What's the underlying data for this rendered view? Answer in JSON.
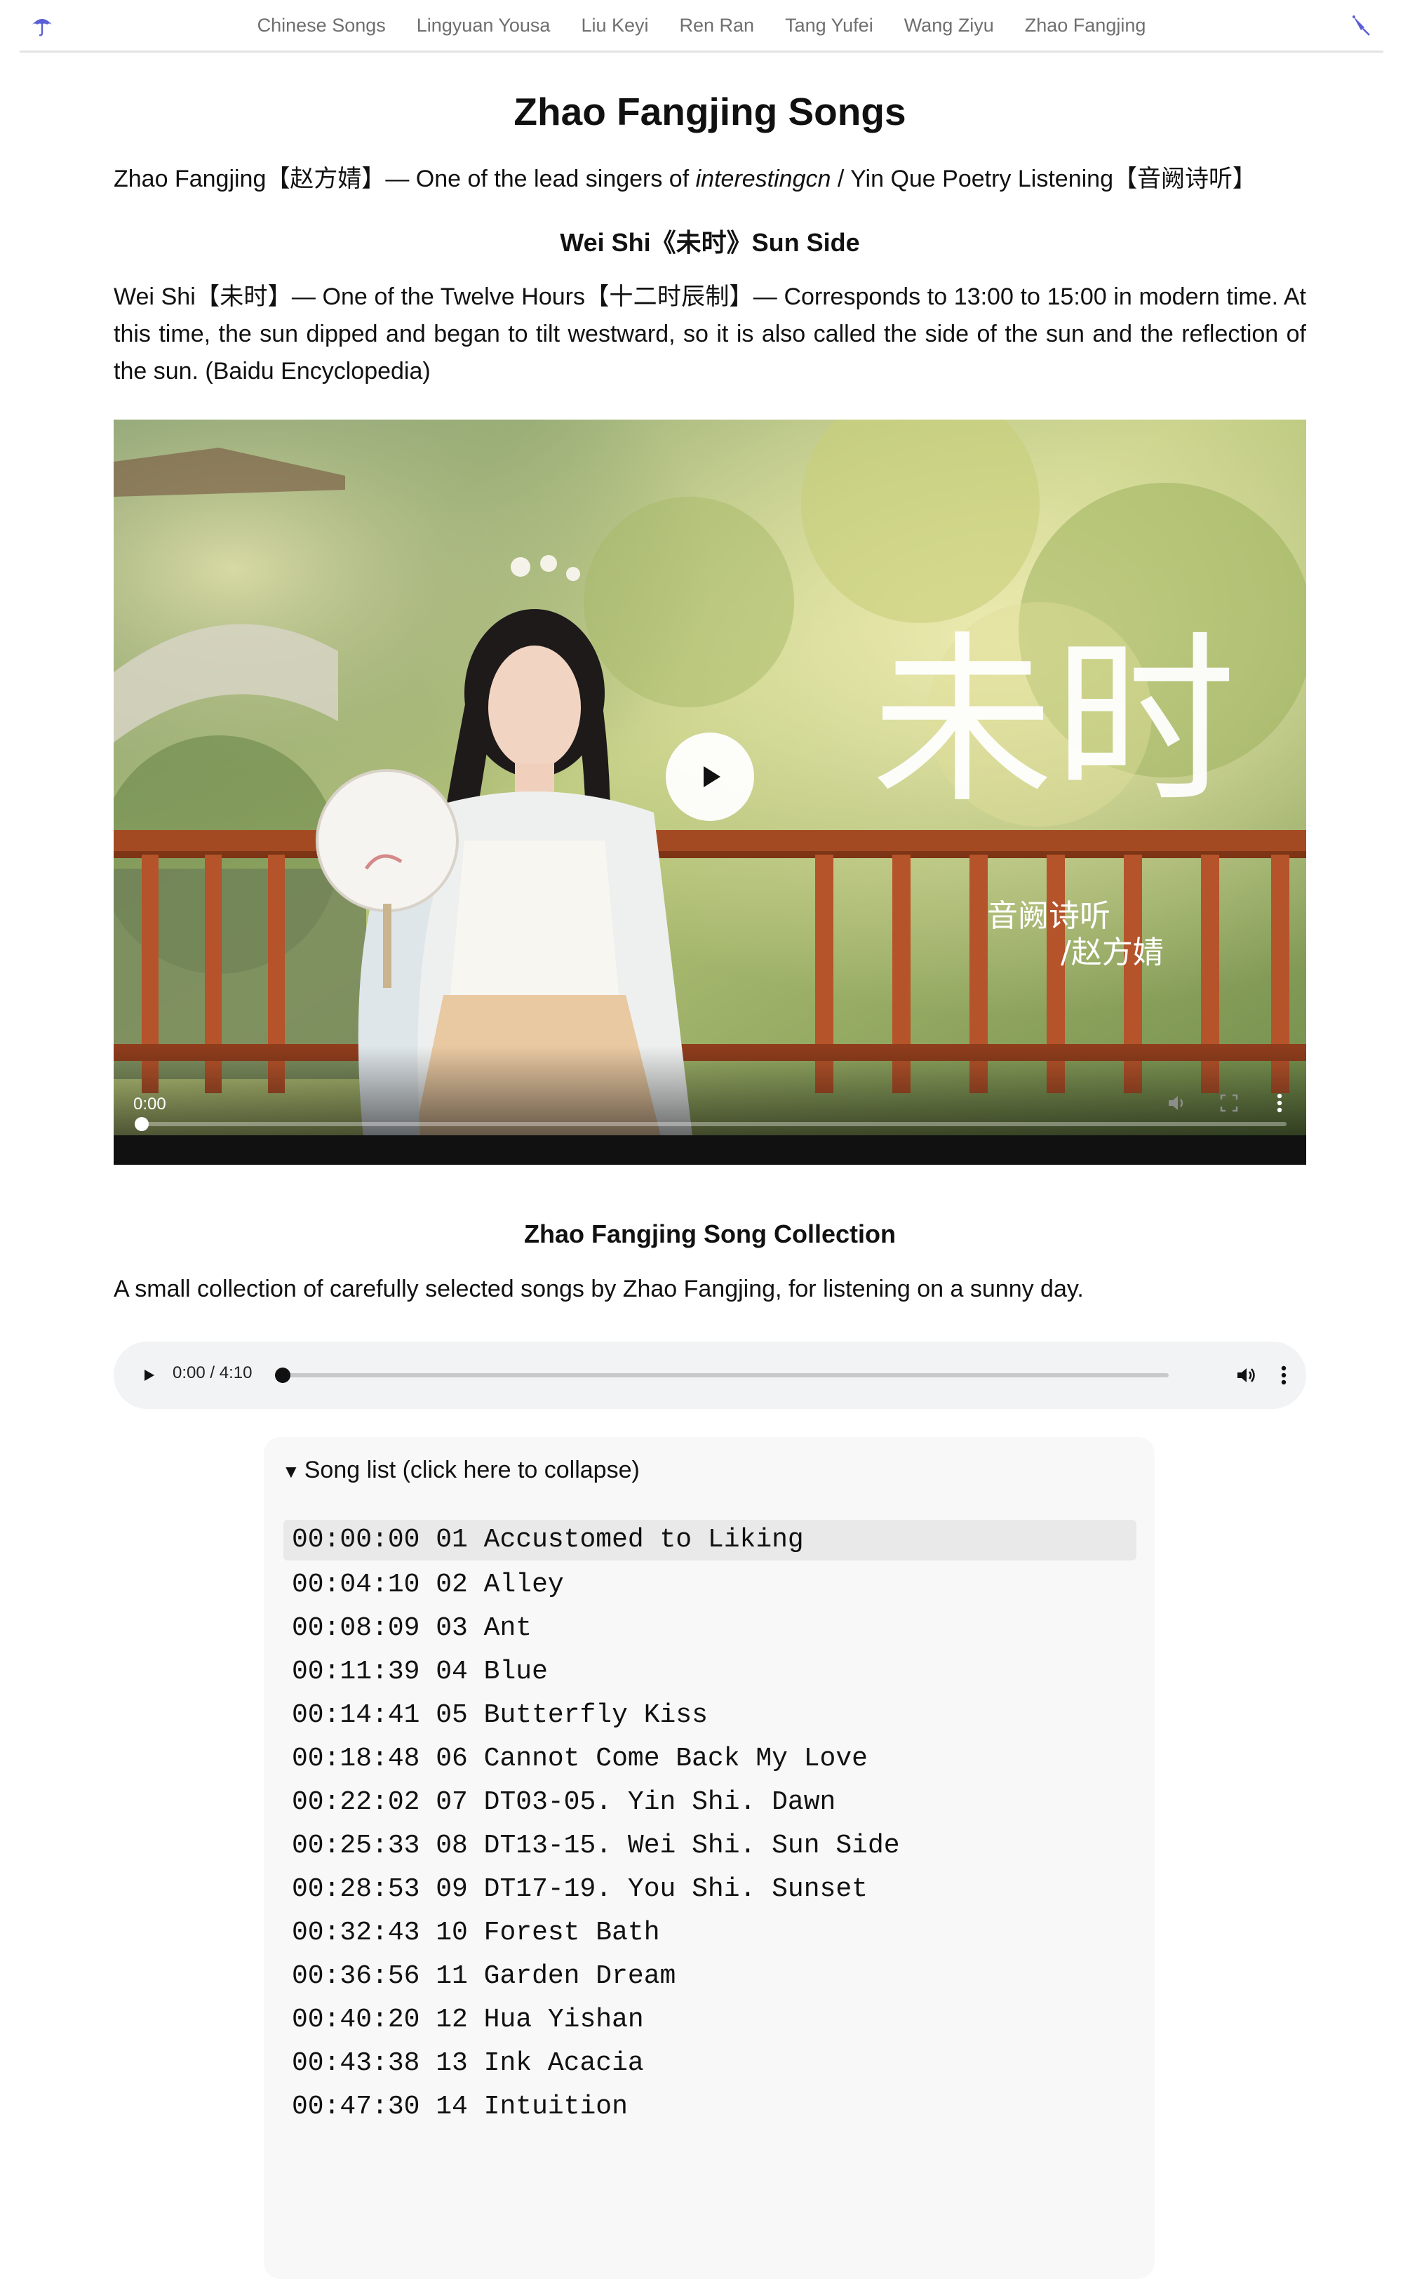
{
  "nav": {
    "left_icon": "umbrella-icon",
    "right_icon": "closed-umbrella-icon",
    "links": [
      "Chinese Songs",
      "Lingyuan Yousa",
      "Liu Keyi",
      "Ren Ran",
      "Tang Yufei",
      "Wang Ziyu",
      "Zhao Fangjing"
    ]
  },
  "page": {
    "title": "Zhao Fangjing Songs",
    "intro_pre": "Zhao Fangjing【赵方婧】— One of the lead singers of ",
    "intro_em": "interestingcn",
    "intro_post": " / Yin Que Poetry Listening【音阙诗听】"
  },
  "weishi": {
    "title": "Wei Shi《未时》Sun Side",
    "description": "Wei Shi【未时】— One of the Twelve Hours【十二时辰制】— Corresponds to 13:00 to 15:00 in modern time. At this time, the sun dipped and began to tilt westward, so it is also called the side of the sun and the reflection of the sun. (Baidu Encyclopedia)"
  },
  "video": {
    "calligraphy": "未时",
    "caption_line1": "音阙诗听",
    "caption_line2": "/赵方婧",
    "current_time": "0:00",
    "progress": 0
  },
  "collection": {
    "title": "Zhao Fangjing Song Collection",
    "description": "A small collection of carefully selected songs by Zhao Fangjing, for listening on a sunny day."
  },
  "audio": {
    "time_display": "0:00 / 4:10",
    "progress": 0
  },
  "songlist": {
    "summary": "Song list (click here to collapse)",
    "songs": [
      {
        "time": "00:00:00",
        "title": "01 Accustomed to Liking"
      },
      {
        "time": "00:04:10",
        "title": "02 Alley"
      },
      {
        "time": "00:08:09",
        "title": "03 Ant"
      },
      {
        "time": "00:11:39",
        "title": "04 Blue"
      },
      {
        "time": "00:14:41",
        "title": "05 Butterfly Kiss"
      },
      {
        "time": "00:18:48",
        "title": "06 Cannot Come Back My Love"
      },
      {
        "time": "00:22:02",
        "title": "07 DT03-05. Yin Shi. Dawn"
      },
      {
        "time": "00:25:33",
        "title": "08 DT13-15. Wei Shi. Sun Side"
      },
      {
        "time": "00:28:53",
        "title": "09 DT17-19. You Shi. Sunset"
      },
      {
        "time": "00:32:43",
        "title": "10 Forest Bath"
      },
      {
        "time": "00:36:56",
        "title": "11 Garden Dream"
      },
      {
        "time": "00:40:20",
        "title": "12 Hua Yishan"
      },
      {
        "time": "00:43:38",
        "title": "13 Ink Acacia"
      },
      {
        "time": "00:47:30",
        "title": "14 Intuition"
      }
    ]
  }
}
